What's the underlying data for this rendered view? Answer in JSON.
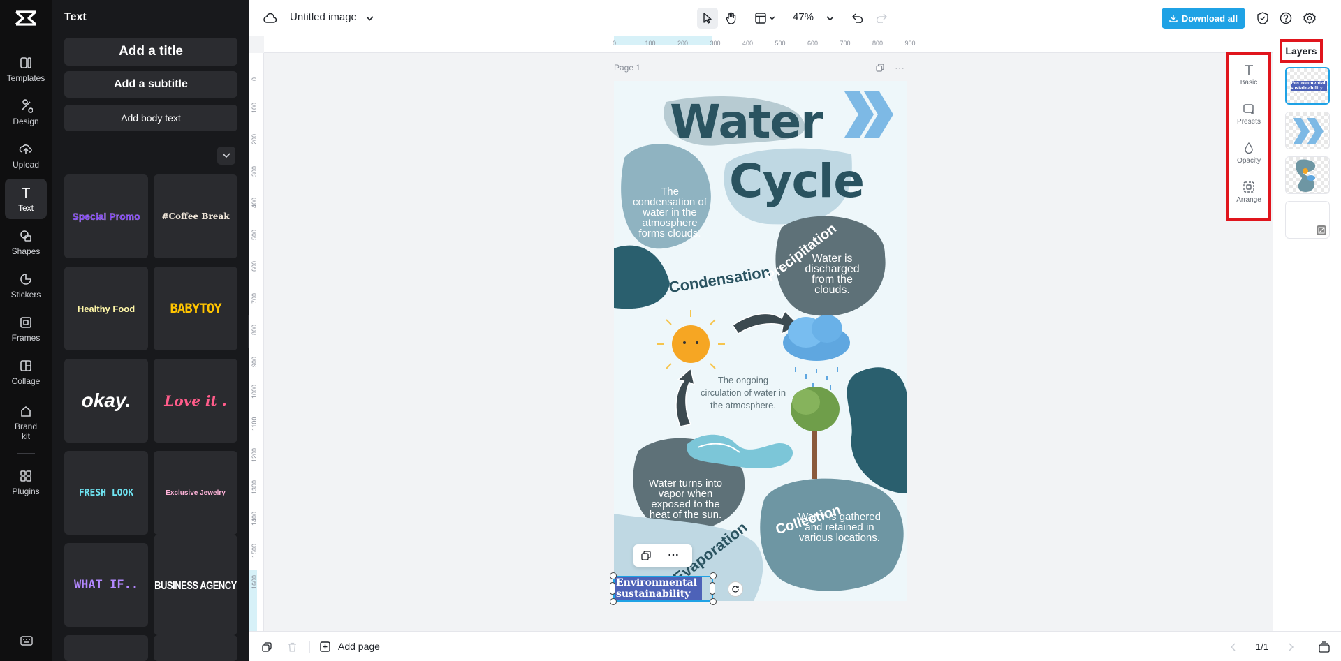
{
  "sidebar": {
    "items": [
      {
        "label": "Templates",
        "icon": "templates-icon"
      },
      {
        "label": "Design",
        "icon": "design-icon"
      },
      {
        "label": "Upload",
        "icon": "upload-icon"
      },
      {
        "label": "Text",
        "icon": "text-icon"
      },
      {
        "label": "Shapes",
        "icon": "shapes-icon"
      },
      {
        "label": "Stickers",
        "icon": "stickers-icon"
      },
      {
        "label": "Frames",
        "icon": "frames-icon"
      },
      {
        "label": "Collage",
        "icon": "collage-icon"
      },
      {
        "label": "Brand kit",
        "icon": "brand-kit-icon"
      },
      {
        "label": "Plugins",
        "icon": "plugins-icon"
      }
    ],
    "active": "Text"
  },
  "text_panel": {
    "title": "Text",
    "add_title": "Add a title",
    "add_subtitle": "Add a subtitle",
    "add_body": "Add body text",
    "presets": [
      {
        "label": "Special Promo",
        "color": "#7b3ff2"
      },
      {
        "label": "#Coffee Break",
        "color": "#f3e9dc"
      },
      {
        "label": "Healthy Food",
        "color": "#fff7a8"
      },
      {
        "label": "BABYTOY",
        "color": "#ffc400"
      },
      {
        "label": "okay.",
        "color": "#ffffff"
      },
      {
        "label": "Love it .",
        "color": "#ff5c8a"
      },
      {
        "label": "FRESH LOOK",
        "color": "#6fe4f2"
      },
      {
        "label": "Exclusive Jewelry",
        "color": "#ffb3d9"
      },
      {
        "label": "WHAT IF..",
        "color": "#b388ff"
      },
      {
        "label": "BUSINESS AGENCY",
        "color": "#ffffff"
      }
    ]
  },
  "topbar": {
    "doc_title": "Untitled image",
    "zoom": "47%",
    "download_label": "Download all"
  },
  "ruler": {
    "h_ticks": [
      "0",
      "100",
      "200",
      "300",
      "400",
      "500",
      "600",
      "700",
      "800",
      "900"
    ],
    "v_ticks": [
      "0",
      "100",
      "200",
      "300",
      "400",
      "500",
      "600",
      "700",
      "800",
      "900",
      "1000",
      "1100",
      "1200",
      "1300",
      "1400",
      "1500",
      "1600"
    ]
  },
  "canvas": {
    "page_label": "Page 1",
    "design": {
      "title_line1": "Water",
      "title_line2": "Cycle",
      "condensation_desc": "The condensation of water in the atmosphere forms clouds.",
      "condensation_label": "Condensation",
      "precipitation_label": "Precipitation",
      "precipitation_desc": "Water is discharged from the clouds.",
      "center_desc": "The ongoing circulation of water in the atmosphere.",
      "evaporation_desc": "Water turns into vapor when exposed to the heat of the sun.",
      "evaporation_label": "Evaporation",
      "collection_label": "Collection",
      "collection_desc": "Water is gathered and retained in various locations.",
      "selected_text": "Environmental sustainability"
    }
  },
  "property_panel": {
    "items": [
      {
        "label": "Basic",
        "icon": "text-basic-icon"
      },
      {
        "label": "Presets",
        "icon": "presets-icon"
      },
      {
        "label": "Opacity",
        "icon": "opacity-icon"
      },
      {
        "label": "Arrange",
        "icon": "arrange-icon"
      }
    ]
  },
  "layers": {
    "title": "Layers",
    "thumb_text": "Environmental sustainability"
  },
  "bottombar": {
    "add_page": "Add page",
    "page_count": "1/1"
  },
  "colors": {
    "accent": "#1fa2e5",
    "highlight_border": "#e0151d",
    "infographic_dark": "#2a5f6e",
    "infographic_mid": "#8fb3c1"
  }
}
